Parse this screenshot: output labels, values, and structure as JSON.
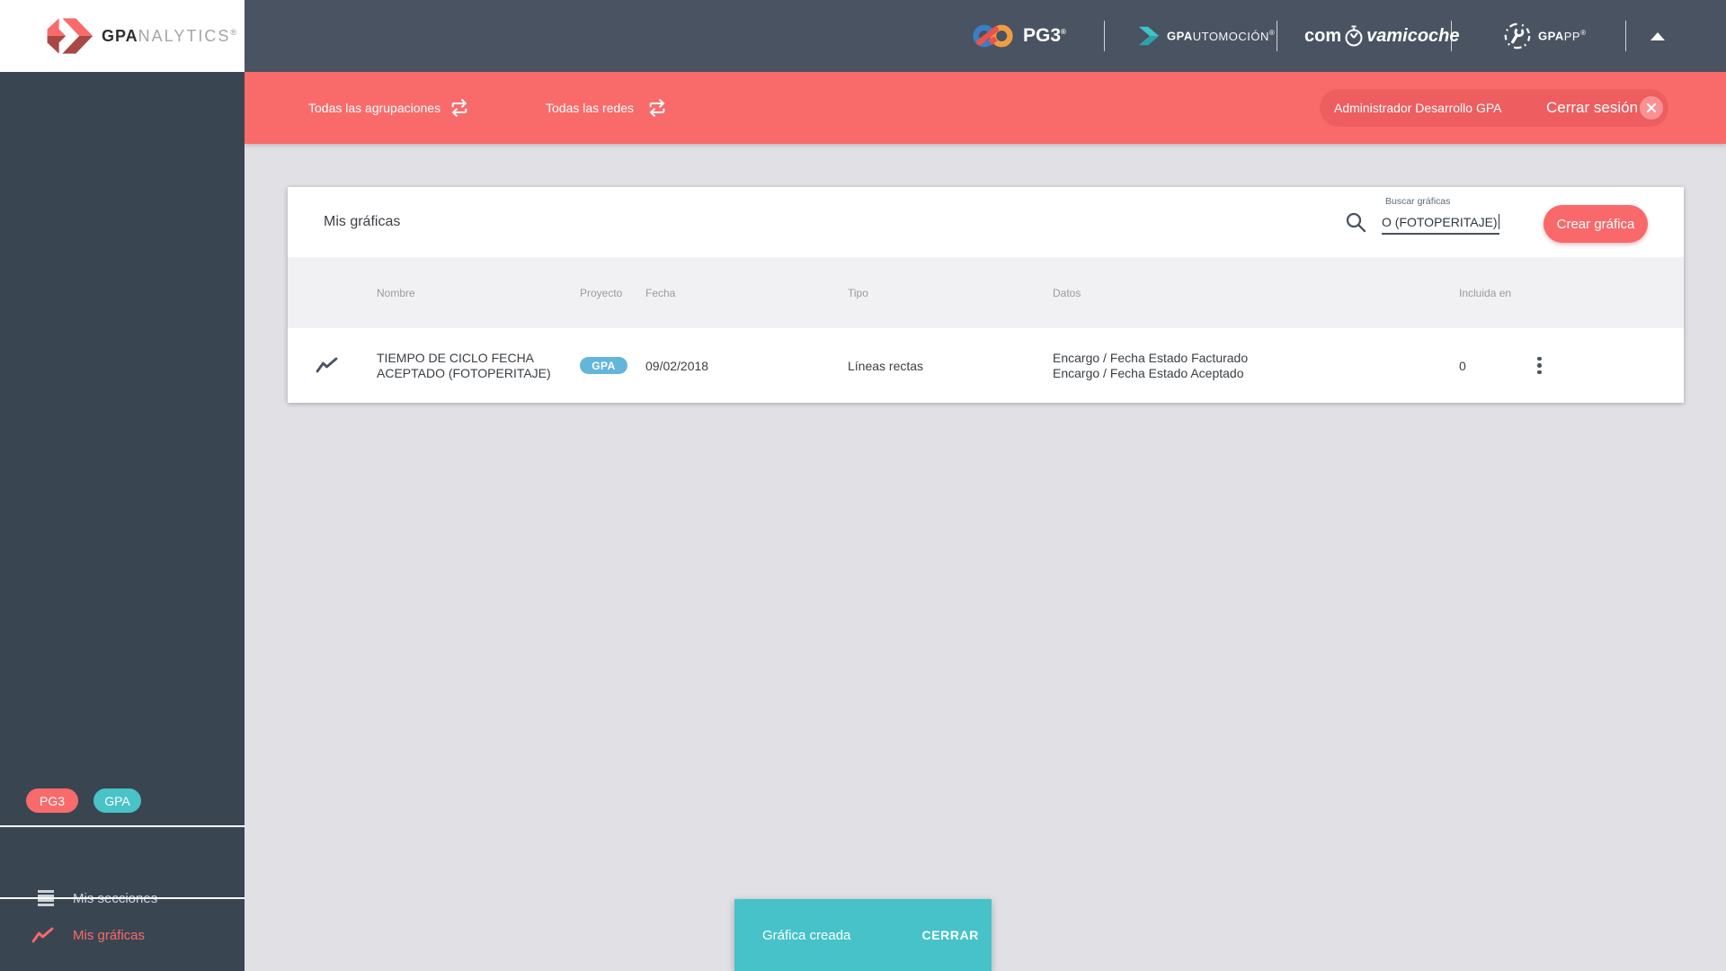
{
  "colors": {
    "topbar_bg": "#4a5362",
    "sidebar_bg": "#3a4552",
    "accent_red": "#f96b6b",
    "accent_red_dark": "#a84744",
    "user_pill_bg": "#ee5d60",
    "logout_circle_bg": "#fb9292",
    "teal": "#46c2c8",
    "project_badge_blue": "#63b5dc",
    "page_bg": "#e1e1e5",
    "table_header_bg": "#f1f1f3",
    "header_text_gray": "#9b9b9b",
    "body_text": "#3a3f44",
    "pg3_logo_blue": "#3a7fc2",
    "pg3_logo_orange": "#f09d3f",
    "pg3_logo_red": "#e8524d"
  },
  "logo": {
    "bold": "GPA",
    "light": "NALYTICS",
    "reg": "®"
  },
  "topbar": {
    "pg3": {
      "label": "PG3",
      "reg": "®"
    },
    "gpautomocion": {
      "bold": "GPA",
      "light": "UTOMOCIÓN",
      "reg": "®"
    },
    "compravamicoche": {
      "prefix": "com",
      "suffix": "vamicoche"
    },
    "gpapp": {
      "bold": "GPA",
      "light": "PP",
      "reg": "®"
    }
  },
  "filterbar": {
    "agrupaciones": "Todas las agrupaciones",
    "redes": "Todas las redes",
    "user": "Administrador Desarrollo GPA",
    "logout": "Cerrar sesión"
  },
  "sidebar": {
    "badge_pg3": "PG3",
    "badge_gpa": "GPA",
    "item_secciones": "Mis secciones",
    "item_graficas": "Mis gráficas"
  },
  "panel": {
    "title": "Mis gráficas",
    "search_label": "Buscar gráficas",
    "search_value": "O (FOTOPERITAJE)",
    "create_button": "Crear gráfica"
  },
  "table": {
    "headers": [
      "Nombre",
      "Proyecto",
      "Fecha",
      "Tipo",
      "Datos",
      "Incluida en"
    ],
    "rows": [
      {
        "name": "TIEMPO DE CICLO FECHA ACEPTADO (FOTOPERITAJE)",
        "project": "GPA",
        "date": "09/02/2018",
        "type": "Líneas rectas",
        "data_series": [
          "Encargo / Fecha Estado Facturado",
          "Encargo / Fecha Estado Aceptado"
        ],
        "included_in": "0"
      }
    ]
  },
  "toast": {
    "message": "Gráfica creada",
    "action": "CERRAR"
  }
}
